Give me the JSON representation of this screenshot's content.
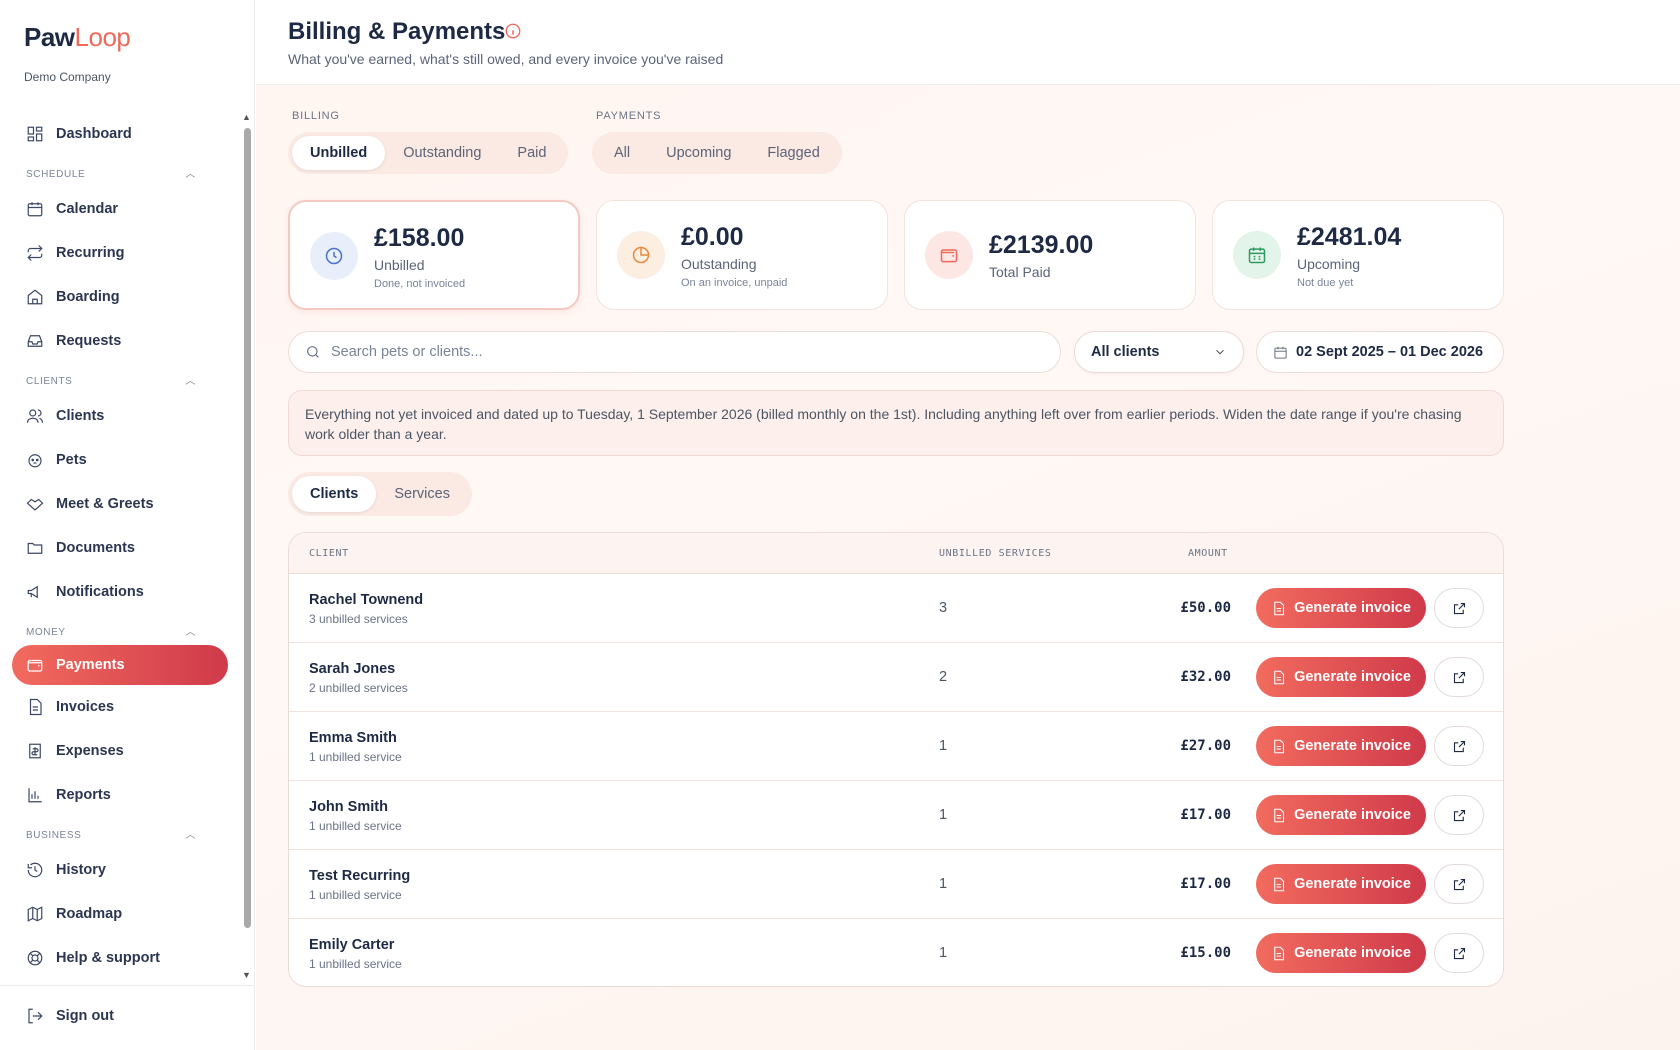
{
  "brand": {
    "name_part1": "Paw",
    "name_part2": "Loop",
    "company": "Demo Company"
  },
  "colors": {
    "accent": "#ef6a5b",
    "accent_dark": "#cf3a4a",
    "text": "#1e2a44",
    "muted": "#5b6477"
  },
  "sidebar": {
    "dashboard": "Dashboard",
    "sections": [
      {
        "title": "SCHEDULE",
        "items": [
          "Calendar",
          "Recurring",
          "Boarding",
          "Requests"
        ]
      },
      {
        "title": "CLIENTS",
        "items": [
          "Clients",
          "Pets",
          "Meet & Greets",
          "Documents",
          "Notifications"
        ]
      },
      {
        "title": "MONEY",
        "items": [
          "Payments",
          "Invoices",
          "Expenses",
          "Reports"
        ]
      },
      {
        "title": "BUSINESS",
        "items": [
          "History",
          "Roadmap",
          "Help & support"
        ]
      }
    ],
    "active_item": "Payments",
    "sign_out": "Sign out"
  },
  "header": {
    "title": "Billing & Payments",
    "subtitle": "What you've earned, what's still owed, and every invoice you've raised"
  },
  "billing_filter": {
    "label": "BILLING",
    "options": [
      "Unbilled",
      "Outstanding",
      "Paid"
    ],
    "selected": "Unbilled"
  },
  "payments_filter": {
    "label": "PAYMENTS",
    "options": [
      "All",
      "Upcoming",
      "Flagged"
    ]
  },
  "cards": [
    {
      "amount": "£158.00",
      "label": "Unbilled",
      "sub": "Done, not invoiced",
      "icon": "clock-icon"
    },
    {
      "amount": "£0.00",
      "label": "Outstanding",
      "sub": "On an invoice, unpaid",
      "icon": "pie-chart-icon"
    },
    {
      "amount": "£2139.00",
      "label": "Total Paid",
      "sub": "",
      "icon": "wallet-icon"
    },
    {
      "amount": "£2481.04",
      "label": "Upcoming",
      "sub": "Not due yet",
      "icon": "calendar-icon"
    }
  ],
  "search": {
    "placeholder": "Search pets or clients...",
    "value": ""
  },
  "client_filter": {
    "selected": "All clients"
  },
  "date_range": "02 Sept 2025 – 01 Dec 2026",
  "notice": "Everything not yet invoiced and dated up to Tuesday, 1 September 2026 (billed monthly on the 1st). Including anything left over from earlier periods. Widen the date range if you're chasing work older than a year.",
  "view_tabs": {
    "options": [
      "Clients",
      "Services"
    ],
    "selected": "Clients"
  },
  "table": {
    "columns": [
      "CLIENT",
      "UNBILLED SERVICES",
      "AMOUNT"
    ],
    "action_label": "Generate invoice",
    "rows": [
      {
        "name": "Rachel Townend",
        "sub": "3 unbilled services",
        "count": "3",
        "amount": "£50.00"
      },
      {
        "name": "Sarah Jones",
        "sub": "2 unbilled services",
        "count": "2",
        "amount": "£32.00"
      },
      {
        "name": "Emma Smith",
        "sub": "1 unbilled service",
        "count": "1",
        "amount": "£27.00"
      },
      {
        "name": "John Smith",
        "sub": "1 unbilled service",
        "count": "1",
        "amount": "£17.00"
      },
      {
        "name": "Test Recurring",
        "sub": "1 unbilled service",
        "count": "1",
        "amount": "£17.00"
      },
      {
        "name": "Emily Carter",
        "sub": "1 unbilled service",
        "count": "1",
        "amount": "£15.00"
      }
    ]
  }
}
